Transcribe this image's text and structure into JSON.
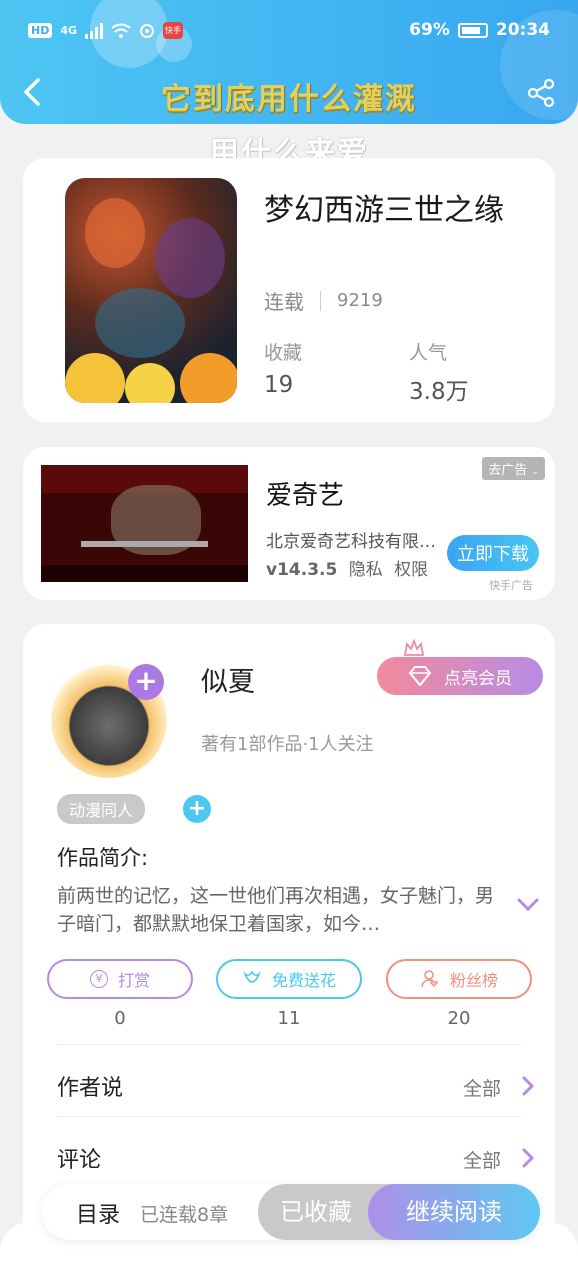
{
  "status_bar": {
    "hd": "HD",
    "signal": "4G",
    "app_badge": "快手",
    "battery": "69%",
    "time": "20:34"
  },
  "header": {
    "title_line1": "它到底用什么灌溉",
    "title_line2": "用什么来爱"
  },
  "book": {
    "title": "梦幻西游三世之缘",
    "status": "连载",
    "word_count": "9219",
    "favorites_label": "收藏",
    "favorites_value": "19",
    "popularity_label": "人气",
    "popularity_value": "3.8万"
  },
  "ad": {
    "title": "爱奇艺",
    "company": "北京爱奇艺科技有限公司",
    "version": "v14.3.5",
    "privacy": "隐私",
    "permissions": "权限",
    "remove_label": "去广告",
    "download_label": "立即下载",
    "source": "快手广告"
  },
  "author": {
    "name": "似夏",
    "meta": "著有1部作品·1人关注",
    "vip_label": "点亮会员",
    "tag": "动漫同人",
    "intro_title": "作品简介:",
    "intro_text": "前两世的记忆，这一世他们再次相遇，女子魅门，男子暗门，都默默地保卫着国家，如今…",
    "actions": [
      {
        "label": "打赏",
        "count": "0",
        "color": "#b58be3",
        "icon": "yuan-icon"
      },
      {
        "label": "免费送花",
        "count": "11",
        "color": "#4cc8ee",
        "icon": "flower-icon"
      },
      {
        "label": "粉丝榜",
        "count": "20",
        "color": "#f0917f",
        "icon": "fans-icon"
      }
    ],
    "author_says_label": "作者说",
    "author_says_all": "全部",
    "comments_label": "评论",
    "comments_all": "全部"
  },
  "bottom_bar": {
    "toc_label": "目录",
    "toc_count": "已连载8章",
    "collected_label": "已收藏",
    "read_label": "继续阅读"
  },
  "colors": {
    "header_gradient": [
      "#4dc6f3",
      "#38a7f0"
    ],
    "accent_purple": "#ab79e3",
    "accent_cyan": "#4cc8ee"
  }
}
